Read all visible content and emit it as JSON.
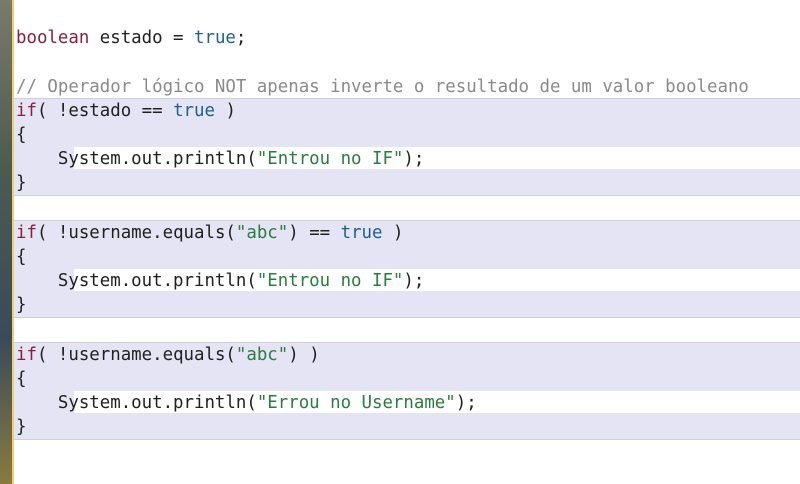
{
  "editor": {
    "line1": {
      "kw": "boolean",
      "rest": " estado = ",
      "bool": "true",
      "end": ";"
    },
    "comment": "// Operador lógico NOT apenas inverte o resultado de um valor booleano",
    "block1": {
      "if_kw": "if",
      "open": "( !estado == ",
      "bool": "true",
      "close": " )",
      "brace_open": "{",
      "print_pre": "    System.out.println(",
      "print_str": "\"Entrou no IF\"",
      "print_post": ");",
      "brace_close": "}"
    },
    "block2": {
      "if_kw": "if",
      "open": "( !username.equals(",
      "arg": "\"abc\"",
      "mid": ") == ",
      "bool": "true",
      "close": " )",
      "brace_open": "{",
      "print_pre": "    System.out.println(",
      "print_str": "\"Entrou no IF\"",
      "print_post": ");",
      "brace_close": "}"
    },
    "block3": {
      "if_kw": "if",
      "open": "( !username.equals(",
      "arg": "\"abc\"",
      "close": ") )",
      "brace_open": "{",
      "print_pre": "    System.out.println(",
      "print_str": "\"Errou no Username\"",
      "print_post": ");",
      "brace_close": "}"
    }
  }
}
